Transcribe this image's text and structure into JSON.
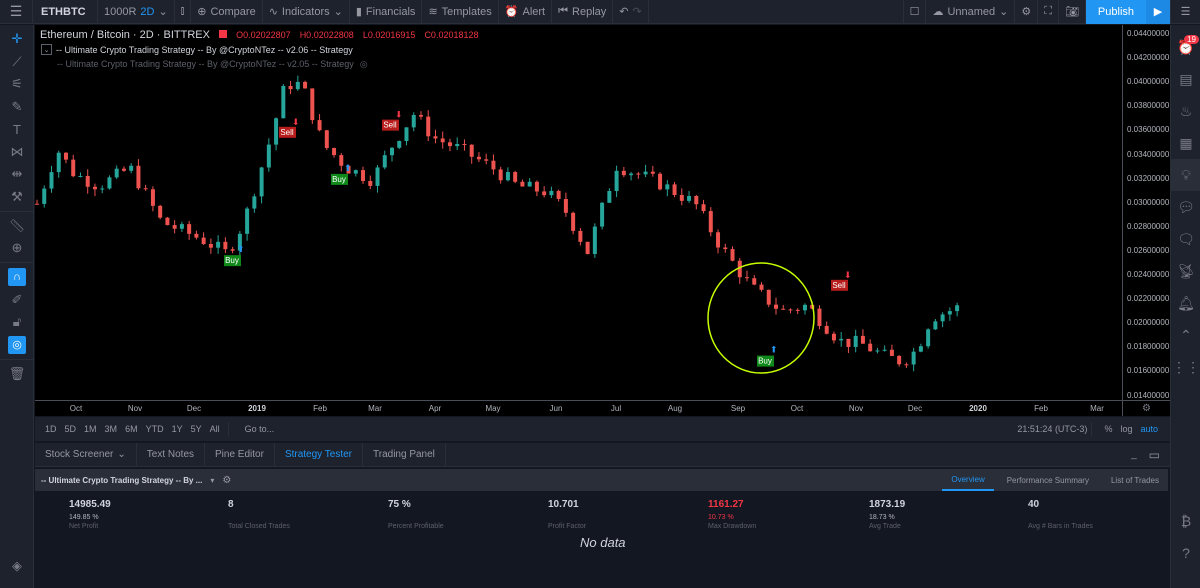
{
  "topbar": {
    "menu_icon": "hamburger-icon",
    "symbol": "ETHBTC",
    "chart_type": "1000R",
    "interval": "2D",
    "compare": "Compare",
    "indicators": "Indicators",
    "financials": "Financials",
    "templates": "Templates",
    "alert": "Alert",
    "replay": "Replay",
    "layout_name": "Unnamed",
    "publish": "Publish"
  },
  "legend": {
    "title": "Ethereum / Bitcoin · 2D · BITTREX",
    "open": "O0.02022807",
    "high": "H0.02022808",
    "low": "L0.02016915",
    "close": "C0.02018128",
    "study1": "-- Ultimate Crypto Trading Strategy -- By @CryptoNTez -- v2.06 -- Strategy",
    "study2": "-- Ultimate Crypto Trading Strategy -- By @CryptoNTez -- v2.05 -- Strategy"
  },
  "price_axis": [
    "0.04400000",
    "0.04200000",
    "0.04000000",
    "0.03800000",
    "0.03600000",
    "0.03400000",
    "0.03200000",
    "0.03000000",
    "0.02800000",
    "0.02600000",
    "0.02400000",
    "0.02200000",
    "0.02000000",
    "0.01800000",
    "0.01600000",
    "0.01400000"
  ],
  "time_axis": [
    {
      "label": "Oct",
      "bold": false
    },
    {
      "label": "Nov",
      "bold": false
    },
    {
      "label": "Dec",
      "bold": false
    },
    {
      "label": "2019",
      "bold": true
    },
    {
      "label": "Feb",
      "bold": false
    },
    {
      "label": "Mar",
      "bold": false
    },
    {
      "label": "Apr",
      "bold": false
    },
    {
      "label": "May",
      "bold": false
    },
    {
      "label": "Jun",
      "bold": false
    },
    {
      "label": "Jul",
      "bold": false
    },
    {
      "label": "Aug",
      "bold": false
    },
    {
      "label": "Sep",
      "bold": false
    },
    {
      "label": "Oct",
      "bold": false
    },
    {
      "label": "Nov",
      "bold": false
    },
    {
      "label": "Dec",
      "bold": false
    },
    {
      "label": "2020",
      "bold": true
    },
    {
      "label": "Feb",
      "bold": false
    },
    {
      "label": "Mar",
      "bold": false
    }
  ],
  "signals": [
    {
      "type": "Buy",
      "price": 0.0262
    },
    {
      "type": "Sell",
      "price": 0.0356
    },
    {
      "type": "Buy",
      "price": 0.033
    },
    {
      "type": "Sell",
      "price": 0.0362
    },
    {
      "type": "Buy",
      "price": 0.0178
    },
    {
      "type": "Sell",
      "price": 0.0228
    }
  ],
  "ranges": [
    "1D",
    "5D",
    "1M",
    "3M",
    "6M",
    "YTD",
    "1Y",
    "5Y",
    "All"
  ],
  "goto": "Go to...",
  "clock": "21:51:24 (UTC-3)",
  "scale": {
    "percent": "%",
    "log": "log",
    "auto": "auto"
  },
  "bottom_tabs": [
    "Stock Screener",
    "Text Notes",
    "Pine Editor",
    "Strategy Tester",
    "Trading Panel"
  ],
  "active_bottom_tab": "Strategy Tester",
  "strategy": {
    "name": "-- Ultimate Crypto Trading Strategy -- By ...",
    "tabs": [
      "Overview",
      "Performance Summary",
      "List of Trades"
    ],
    "active_tab": "Overview",
    "stats": [
      {
        "value": "14985.49",
        "sub": "149.85 %",
        "label": "Net Profit",
        "negative": false
      },
      {
        "value": "8",
        "sub": "",
        "label": "Total Closed Trades",
        "negative": false
      },
      {
        "value": "75 %",
        "sub": "",
        "label": "Percent Profitable",
        "negative": false
      },
      {
        "value": "10.701",
        "sub": "",
        "label": "Profit Factor",
        "negative": false
      },
      {
        "value": "1161.27",
        "sub": "10.73 %",
        "label": "Max Drawdown",
        "negative": true
      },
      {
        "value": "1873.19",
        "sub": "18.73 %",
        "label": "Avg Trade",
        "negative": false
      },
      {
        "value": "40",
        "sub": "",
        "label": "Avg # Bars in Trades",
        "negative": false
      }
    ],
    "no_data": "No data"
  },
  "alerts_badge": "19",
  "colors": {
    "up": "#26a69a",
    "down": "#ef5350",
    "accent": "#2196f3",
    "highlight_circle": "#c6ff00",
    "buy": "#0f8a1a",
    "sell": "#b71c1c"
  }
}
